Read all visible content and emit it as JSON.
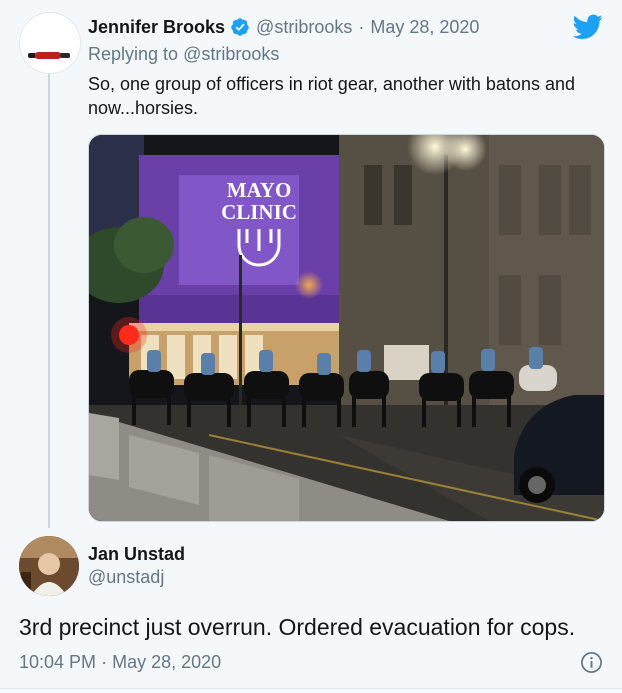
{
  "tweet": {
    "author_name": "Jennifer Brooks",
    "handle": "@stribrooks",
    "separator": "·",
    "date": "May 28, 2020",
    "replying_prefix": "Replying to ",
    "replying_to": "@stribrooks",
    "text": "So, one group of officers in riot gear, another with batons and now...horsies.",
    "icons": {
      "verified": "verified-badge-icon",
      "platform": "twitter-bird-icon"
    }
  },
  "photo_sign": {
    "line1": "MAYO",
    "line2": "CLINIC"
  },
  "embedded_tweet": {
    "author_name": "Jan Unstad",
    "handle": "@unstadj",
    "text": "3rd precinct just overrun. Ordered evacuation for cops.",
    "time": "10:04 PM",
    "separator": "·",
    "date": "May 28, 2020",
    "icons": {
      "info": "info-icon"
    }
  },
  "colors": {
    "background": "#f5f8fa",
    "text_primary": "#14171a",
    "text_secondary": "#657786",
    "twitter_blue": "#1da1f2",
    "border": "#ccd6dd"
  }
}
